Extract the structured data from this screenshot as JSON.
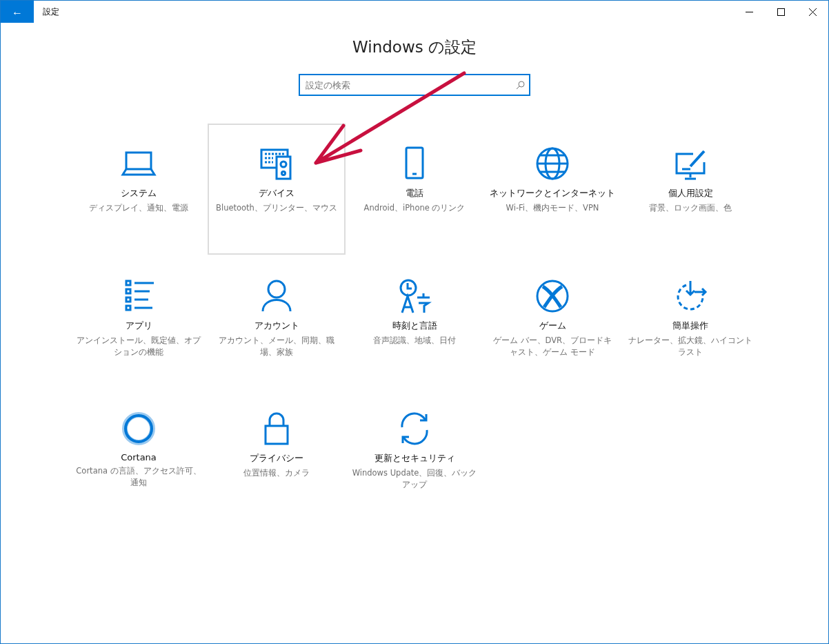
{
  "window": {
    "title": "設定",
    "back_label": "←"
  },
  "heading": "Windows の設定",
  "search": {
    "placeholder": "設定の検索"
  },
  "tiles": [
    {
      "title": "システム",
      "description": "ディスプレイ、通知、電源",
      "highlighted": false
    },
    {
      "title": "デバイス",
      "description": "Bluetooth、プリンター、マウス",
      "highlighted": true
    },
    {
      "title": "電話",
      "description": "Android、iPhone のリンク",
      "highlighted": false
    },
    {
      "title": "ネットワークとインターネット",
      "description": "Wi-Fi、機内モード、VPN",
      "highlighted": false
    },
    {
      "title": "個人用設定",
      "description": "背景、ロック画面、色",
      "highlighted": false
    },
    {
      "title": "アプリ",
      "description": "アンインストール、既定値、オプションの機能",
      "highlighted": false
    },
    {
      "title": "アカウント",
      "description": "アカウント、メール、同期、職場、家族",
      "highlighted": false
    },
    {
      "title": "時刻と言語",
      "description": "音声認識、地域、日付",
      "highlighted": false
    },
    {
      "title": "ゲーム",
      "description": "ゲーム バー、DVR、ブロードキャスト、ゲーム モード",
      "highlighted": false
    },
    {
      "title": "簡単操作",
      "description": "ナレーター、拡大鏡、ハイコントラスト",
      "highlighted": false
    },
    {
      "title": "Cortana",
      "description": "Cortana の言語、アクセス許可、通知",
      "highlighted": false
    },
    {
      "title": "プライバシー",
      "description": "位置情報、カメラ",
      "highlighted": false
    },
    {
      "title": "更新とセキュリティ",
      "description": "Windows Update、回復、バックアップ",
      "highlighted": false
    }
  ]
}
